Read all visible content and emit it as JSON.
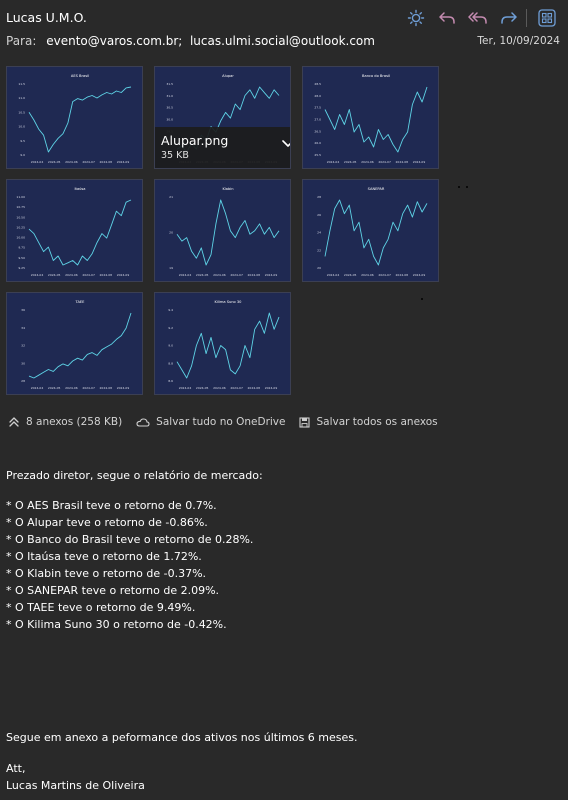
{
  "header": {
    "sender": "Lucas U.M.O.",
    "to_label": "Para:",
    "recipients": [
      "evento@varos.com.br;",
      "lucas.ulmi.social@outlook.com"
    ],
    "date": "Ter, 10/09/2024",
    "toolbar_icons": [
      "sun-icon",
      "reply-icon",
      "reply-all-icon",
      "forward-icon",
      "apps-icon"
    ],
    "accent_color": "#6f9ed6"
  },
  "attachments": {
    "items": [
      {
        "title": "AES Brasil",
        "file": "AES Brasil.png"
      },
      {
        "title": "Alupar",
        "file": "Alupar.png"
      },
      {
        "title": "Banco do Brasil",
        "file": "Banco do Brasil.png"
      },
      {
        "title": "Itaúsa",
        "file": "Itaúsa.png"
      },
      {
        "title": "Klabin",
        "file": "Klabin.png"
      },
      {
        "title": "SANEPAR",
        "file": "SANEPAR.png"
      },
      {
        "title": "TAEE",
        "file": "TAEE.png"
      },
      {
        "title": "Kilima Suno 30",
        "file": "Kilima Suno 30.png"
      }
    ],
    "hover": {
      "file": "Alupar.png",
      "size": "35 KB"
    },
    "x_ticks": [
      "2024-04",
      "2024-05",
      "2024-06",
      "2024-07",
      "2024-08",
      "2024-09"
    ],
    "line_color": "#5ed3e6",
    "bg_color": "#1f2952",
    "count_label": "8 anexos (258 KB)",
    "save_onedrive": "Salvar tudo no OneDrive",
    "save_all": "Salvar todos os anexos"
  },
  "chart_data": [
    {
      "type": "line",
      "title": "AES Brasil",
      "x": [
        "2024-04",
        "2024-05",
        "2024-06",
        "2024-07",
        "2024-08",
        "2024-09"
      ],
      "y_ticks": [
        "11.5",
        "11.0",
        "10.5",
        "10.0",
        "9.5",
        "9.0"
      ],
      "values": [
        10.65,
        10.4,
        10.1,
        9.9,
        9.35,
        9.6,
        9.8,
        9.95,
        10.3,
        11.0,
        11.1,
        11.05,
        11.15,
        11.2,
        11.12,
        11.22,
        11.3,
        11.25,
        11.35,
        11.3,
        11.45,
        11.48
      ]
    },
    {
      "type": "line",
      "title": "Alupar",
      "x": [
        "2024-04",
        "2024-05",
        "2024-06",
        "2024-07",
        "2024-08",
        "2024-09"
      ],
      "y_ticks": [
        "31.5",
        "31.0",
        "30.5",
        "30.0",
        "29.5",
        "29.0",
        "28.5"
      ],
      "values": [
        28.8,
        28.9,
        28.7,
        29.0,
        28.8,
        29.3,
        29.1,
        29.6,
        29.4,
        29.8,
        30.1,
        29.9,
        30.4,
        30.2,
        30.7,
        30.9,
        30.6,
        31.0,
        30.8,
        30.6,
        30.9,
        30.7
      ]
    },
    {
      "type": "line",
      "title": "Banco do Brasil",
      "x": [
        "2024-04",
        "2024-05",
        "2024-06",
        "2024-07",
        "2024-08",
        "2024-09"
      ],
      "y_ticks": [
        "28.5",
        "28.0",
        "27.5",
        "27.0",
        "26.5",
        "26.0",
        "25.5"
      ],
      "values": [
        27.4,
        27.0,
        26.6,
        27.2,
        26.8,
        27.4,
        26.5,
        26.8,
        26.1,
        26.3,
        25.9,
        26.6,
        26.2,
        26.4,
        26.0,
        25.7,
        26.2,
        26.5,
        27.6,
        28.1,
        27.7,
        28.3
      ]
    },
    {
      "type": "line",
      "title": "Itaúsa",
      "x": [
        "2024-04",
        "2024-05",
        "2024-06",
        "2024-07",
        "2024-08",
        "2024-09"
      ],
      "y_ticks": [
        "11.00",
        "10.75",
        "10.50",
        "10.25",
        "10.00",
        "9.75",
        "9.50",
        "9.25"
      ],
      "values": [
        10.3,
        10.2,
        10.0,
        9.8,
        9.9,
        9.6,
        9.7,
        9.5,
        9.55,
        9.6,
        9.5,
        9.7,
        9.6,
        9.75,
        10.0,
        10.2,
        10.1,
        10.4,
        10.7,
        10.6,
        10.9,
        10.95
      ]
    },
    {
      "type": "line",
      "title": "Klabin",
      "x": [
        "2024-04",
        "2024-05",
        "2024-06",
        "2024-07",
        "2024-08",
        "2024-09"
      ],
      "y_ticks": [
        "21",
        "20",
        "19"
      ],
      "values": [
        20.0,
        19.8,
        19.9,
        19.5,
        19.3,
        19.6,
        19.1,
        19.4,
        20.3,
        21.0,
        20.6,
        20.1,
        19.9,
        20.2,
        20.4,
        20.0,
        20.1,
        20.3,
        20.0,
        20.2,
        19.9,
        20.1
      ]
    },
    {
      "type": "line",
      "title": "SANEPAR",
      "x": [
        "2024-04",
        "2024-05",
        "2024-06",
        "2024-07",
        "2024-08",
        "2024-09"
      ],
      "y_ticks": [
        "28",
        "26",
        "24",
        "22",
        "20"
      ],
      "values": [
        21.0,
        22.5,
        23.8,
        24.3,
        23.5,
        24.0,
        22.5,
        23.0,
        21.5,
        22.0,
        21.0,
        20.5,
        21.5,
        22.0,
        23.0,
        22.5,
        23.5,
        24.0,
        23.3,
        24.2,
        23.6,
        24.1
      ]
    },
    {
      "type": "line",
      "title": "TAEE",
      "x": [
        "2024-04",
        "2024-05",
        "2024-06",
        "2024-07",
        "2024-08",
        "2024-09"
      ],
      "y_ticks": [
        "36",
        "34",
        "32",
        "30",
        "28"
      ],
      "values": [
        29.5,
        29.3,
        29.6,
        29.9,
        30.2,
        30.0,
        30.5,
        30.8,
        30.6,
        31.1,
        31.4,
        31.2,
        31.8,
        32.0,
        31.7,
        32.3,
        32.6,
        32.9,
        33.4,
        33.8,
        34.6,
        36.2
      ]
    },
    {
      "type": "line",
      "title": "Kilima Suno 30",
      "x": [
        "2024-04",
        "2024-05",
        "2024-06",
        "2024-07",
        "2024-08",
        "2024-09"
      ],
      "y_ticks": [
        "9.4",
        "9.2",
        "9.0",
        "8.8",
        "8.6"
      ],
      "values": [
        8.8,
        8.7,
        8.6,
        8.75,
        9.0,
        9.15,
        8.9,
        9.1,
        8.85,
        9.0,
        8.95,
        8.7,
        8.65,
        8.75,
        9.0,
        8.85,
        9.2,
        9.3,
        9.15,
        9.4,
        9.2,
        9.35
      ]
    }
  ],
  "message": {
    "greeting": "Prezado diretor, segue o relatório de mercado:",
    "lines": [
      "* O AES Brasil teve o retorno de 0.7%.",
      "* O Alupar teve o retorno de -0.86%.",
      "* O Banco do Brasil teve o retorno de 0.28%.",
      "* O Itaúsa teve o retorno de 1.72%.",
      "* O Klabin teve o retorno de -0.37%.",
      "* O SANEPAR teve o retorno de 2.09%.",
      "* O TAEE teve o retorno de 9.49%.",
      "* O Kilima Suno 30 o retorno de -0.42%."
    ],
    "closing": "Segue em anexo a peformance dos ativos nos últimos 6 meses.",
    "signoff": "Att,",
    "signature": "Lucas Martins de Oliveira"
  }
}
